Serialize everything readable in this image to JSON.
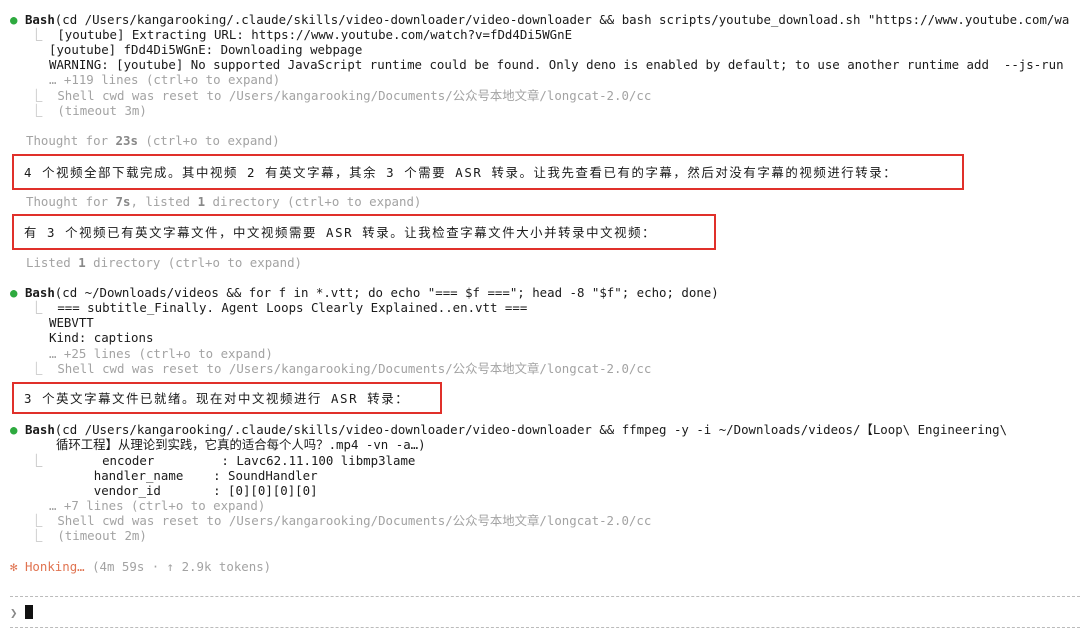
{
  "block1": {
    "tool": "Bash",
    "command": "(cd /Users/kangarooking/.claude/skills/video-downloader/video-downloader && bash scripts/youtube_download.sh \"https://www.youtube.com/wa",
    "out1": "[youtube] Extracting URL: https://www.youtube.com/watch?v=fDd4Di5WGnE",
    "out2": "[youtube] fDd4Di5WGnE: Downloading webpage",
    "out3": "WARNING: [youtube] No supported JavaScript runtime could be found. Only deno is enabled by default; to use another runtime add  --js-run",
    "more": "… +119 lines (ctrl+o to expand)",
    "cwd": "Shell cwd was reset to /Users/kangarooking/Documents/公众号本地文章/longcat-2.0/cc",
    "timeout": "(timeout 3m)"
  },
  "thought1": {
    "prefix": "Thought for ",
    "dur": "23s",
    "suffix": " (ctrl+o to expand)"
  },
  "msg1": "4 个视频全部下载完成。其中视频 2 有英文字幕，其余 3 个需要 ASR 转录。让我先查看已有的字幕，然后对没有字幕的视频进行转录：",
  "thought2": {
    "prefix": "Thought for ",
    "dur": "7s",
    "mid": ", listed ",
    "count": "1",
    "suffix": " directory (ctrl+o to expand)"
  },
  "msg2": "有 3 个视频已有英文字幕文件，中文视频需要 ASR 转录。让我检查字幕文件大小并转录中文视频：",
  "listed": {
    "prefix": "Listed ",
    "count": "1",
    "suffix": " directory (ctrl+o to expand)"
  },
  "block2": {
    "tool": "Bash",
    "command": "(cd ~/Downloads/videos && for f in *.vtt; do echo \"=== $f ===\"; head -8 \"$f\"; echo; done)",
    "out1": "=== subtitle_Finally. Agent Loops Clearly Explained..en.vtt ===",
    "out2": "WEBVTT",
    "out3": "Kind: captions",
    "more": "… +25 lines (ctrl+o to expand)",
    "cwd": "Shell cwd was reset to /Users/kangarooking/Documents/公众号本地文章/longcat-2.0/cc"
  },
  "msg3": "3 个英文字幕文件已就绪。现在对中文视频进行 ASR 转录：",
  "block3": {
    "tool": "Bash",
    "command": "(cd /Users/kangarooking/.claude/skills/video-downloader/video-downloader && ffmpeg -y -i ~/Downloads/videos/【Loop\\ Engineering\\",
    "command2": "循环工程】从理论到实践，它真的适合每个人吗？.mp4 -vn -a…)",
    "out1": "      encoder         : Lavc62.11.100 libmp3lame",
    "out2": "      handler_name    : SoundHandler",
    "out3": "      vendor_id       : [0][0][0][0]",
    "more": "… +7 lines (ctrl+o to expand)",
    "cwd": "Shell cwd was reset to /Users/kangarooking/Documents/公众号本地文章/longcat-2.0/cc",
    "timeout": "(timeout 2m)"
  },
  "status": {
    "star": "✻",
    "label": "Honking…",
    "meta": " (4m 59s · ↑ 2.9k tokens)"
  },
  "prompt": {
    "symbol": "❯"
  },
  "colors": {
    "success_dot": "#2eaa3f",
    "highlight_border": "#e0302a",
    "status_accent": "#e07350",
    "dim_text": "#a3a3a3"
  }
}
